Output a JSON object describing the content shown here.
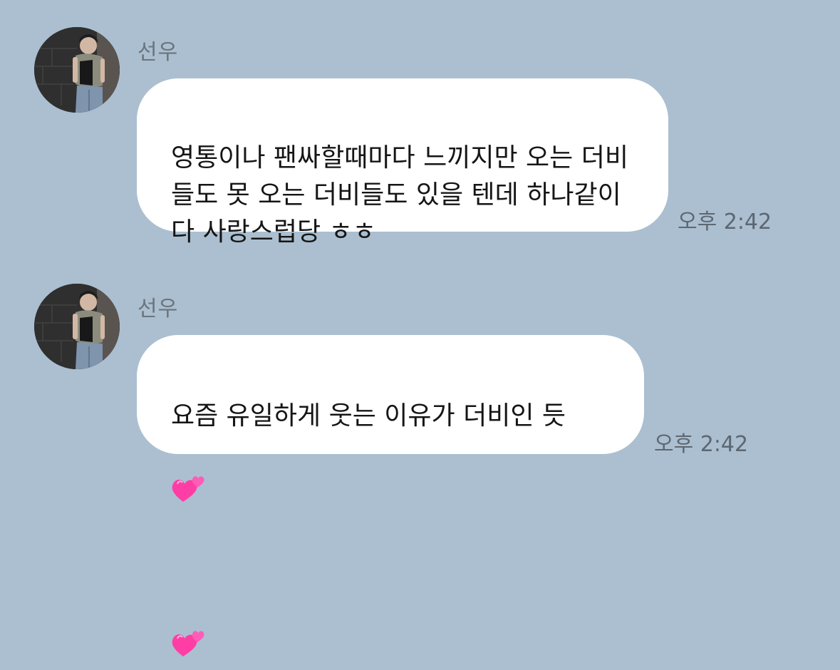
{
  "messages": [
    {
      "sender": "선우",
      "avatar_icon": "profile-photo-icon",
      "text": "영통이나 팬싸할때마다 느끼지만 오는 더비\n들도 못 오는 더비들도 있을 텐데 하나같이\n다 사랑스럽당 ㅎㅎ",
      "time": "오후 2:42"
    },
    {
      "sender": "선우",
      "avatar_icon": "profile-photo-icon",
      "text": "요즘 유일하게 웃는 이유가 더비인 듯",
      "emoji_icon": "two-hearts-emoji-icon",
      "time": "오후 2:42"
    }
  ],
  "colors": {
    "background": "#abbfd0",
    "bubble": "#ffffff",
    "heart": "#ff3ea5"
  }
}
